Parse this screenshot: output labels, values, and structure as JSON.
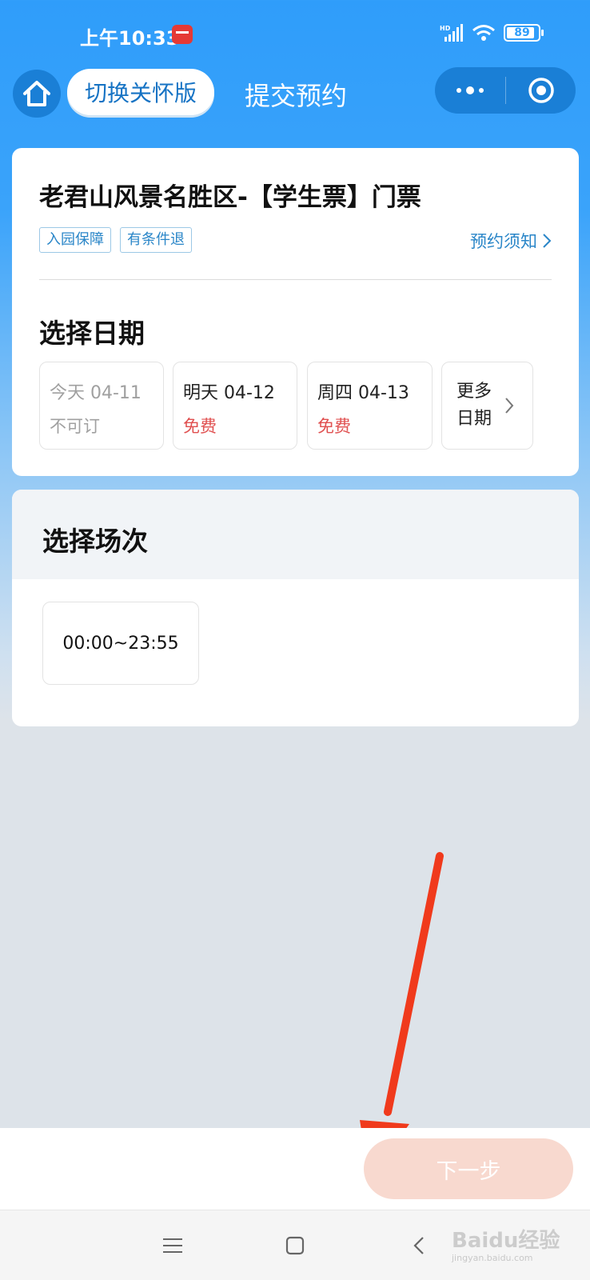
{
  "status_bar": {
    "time": "上午10:33",
    "signal_icon": "signal-hd-icon",
    "wifi_icon": "wifi-icon",
    "battery": "89"
  },
  "header": {
    "home_icon": "home-icon",
    "care_mode_label": "切换关怀版",
    "title": "提交预约",
    "more_icon": "more-dots-icon",
    "close_icon": "target-close-icon"
  },
  "ticket": {
    "title": "老君山风景名胜区-【学生票】门票",
    "tags": [
      "入园保障",
      "有条件退"
    ],
    "notice_label": "预约须知"
  },
  "date_section": {
    "heading": "选择日期",
    "dates": [
      {
        "label": "今天 04-11",
        "status": "不可订",
        "disabled": true
      },
      {
        "label": "明天 04-12",
        "status": "免费",
        "disabled": false
      },
      {
        "label": "周四 04-13",
        "status": "免费",
        "disabled": false
      }
    ],
    "more_label_1": "更多",
    "more_label_2": "日期"
  },
  "session_section": {
    "heading": "选择场次",
    "sessions": [
      "00:00~23:55"
    ]
  },
  "footer": {
    "next_label": "下一步"
  },
  "nav": {
    "menu_icon": "menu-icon",
    "home_icon": "square-home-icon",
    "back_icon": "back-chevron-icon"
  },
  "watermark": {
    "brand": "Baidu经验",
    "url": "jingyan.baidu.com"
  },
  "colors": {
    "header_blue": "#2f9dfa",
    "accent_blue": "#2a86c8",
    "free_red": "#e05050",
    "next_button": "#f8d9cf",
    "annotation_arrow": "#f03a1c"
  }
}
